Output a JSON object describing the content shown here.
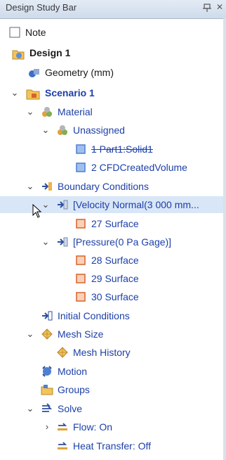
{
  "window": {
    "title": "Design Study Bar"
  },
  "tree": {
    "note": "Note",
    "design": "Design 1",
    "geometry": "Geometry (mm)",
    "scenario": "Scenario 1",
    "material": "Material",
    "unassigned": "Unassigned",
    "part1": "1 Part1:Solid1",
    "part2": "2 CFDCreatedVolume",
    "boundary": "Boundary Conditions",
    "velocity": "[Velocity Normal(3 000 mm...",
    "surf27": "27 Surface",
    "pressure": "[Pressure(0 Pa Gage)]",
    "surf28": "28 Surface",
    "surf29": "29 Surface",
    "surf30": "30 Surface",
    "initial": "Initial Conditions",
    "mesh_size": "Mesh Size",
    "mesh_history": "Mesh History",
    "motion": "Motion",
    "groups": "Groups",
    "solve": "Solve",
    "flow": "Flow: On",
    "heat": "Heat Transfer: Off"
  },
  "colors": {
    "selection": "#d8e6f7",
    "link_blue": "#1c3fa8",
    "volume_blue": "#4f7fd0",
    "surface_orange": "#d9622b",
    "mesh_yellow": "#e6a83a"
  }
}
